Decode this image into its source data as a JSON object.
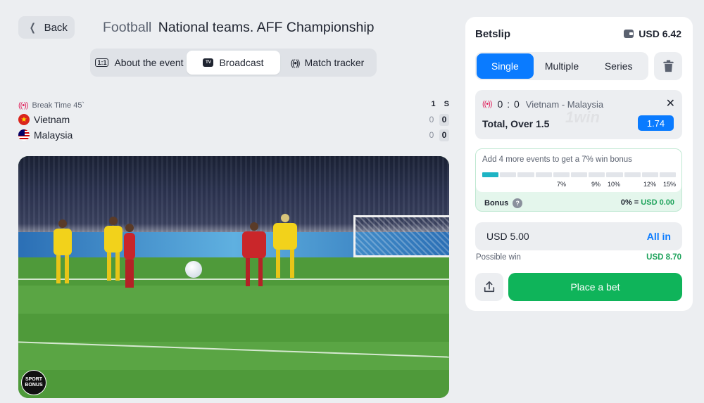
{
  "header": {
    "back_label": "Back",
    "sport": "Football",
    "league": "National teams. AFF Championship"
  },
  "tabs": [
    {
      "label": "About the event",
      "icon": "info-1x1-icon",
      "active": false
    },
    {
      "label": "Broadcast",
      "icon": "tv-icon",
      "active": true
    },
    {
      "label": "Match tracker",
      "icon": "radio-signal-icon",
      "active": false
    }
  ],
  "match": {
    "status": "Break Time 45`",
    "col_period": "1",
    "col_score": "S",
    "teams": [
      {
        "name": "Vietnam",
        "period1": "0",
        "score": "0",
        "flag": "vietnam-flag-icon"
      },
      {
        "name": "Malaysia",
        "period1": "0",
        "score": "0",
        "flag": "malaysia-flag-icon"
      }
    ]
  },
  "video": {
    "watermark_line1": "SPORT",
    "watermark_line2": "BONUS"
  },
  "betslip": {
    "title": "Betslip",
    "balance": "USD 6.42",
    "modes": [
      {
        "label": "Single",
        "active": true
      },
      {
        "label": "Multiple",
        "active": false
      },
      {
        "label": "Series",
        "active": false
      }
    ],
    "bet": {
      "score": "0 : 0",
      "event": "Vietnam - Malaysia",
      "market": "Total, Over 1.5",
      "odds": "1.74",
      "brand_watermark": "1win"
    },
    "bonus": {
      "text": "Add 4 more events to get a 7% win bonus",
      "ticks": [
        "7%",
        "9%",
        "10%",
        "12%",
        "15%"
      ],
      "progress_segments": 11,
      "progress_filled": 1,
      "label": "Bonus",
      "help": "?",
      "percent": "0% =",
      "amount": "USD 0.00"
    },
    "stake_value": "USD 5.00",
    "all_in": "All in",
    "possible_win_label": "Possible win",
    "possible_win_value": "USD 8.70",
    "place_bet": "Place a bet"
  },
  "colors": {
    "accent": "#0a7bff",
    "success": "#0fb45a",
    "background": "#eceef1",
    "live": "#e0245e"
  }
}
